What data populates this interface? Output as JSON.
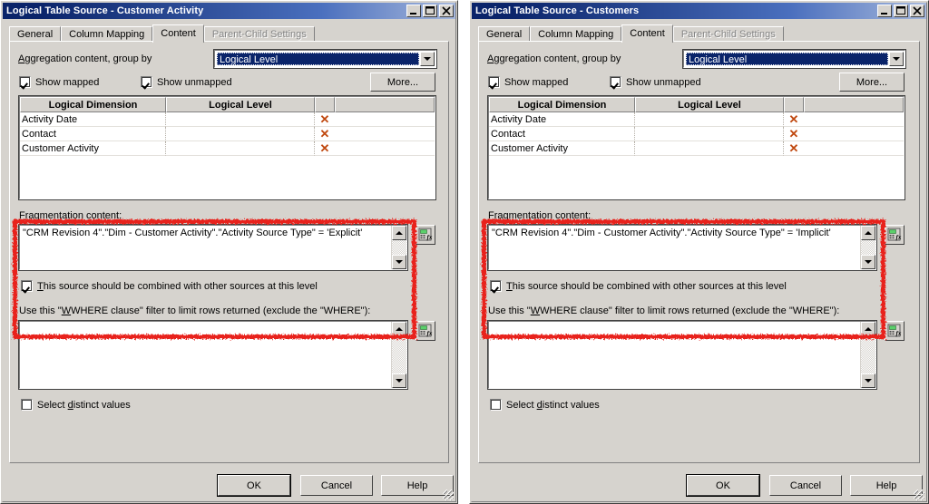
{
  "windows": [
    {
      "title": "Logical Table Source - Customer Activity",
      "titlebar_buttons": {
        "minimize": "minimize-icon",
        "maximize": "maximize-icon",
        "close": "close-icon"
      },
      "tabs": [
        {
          "label": "General",
          "state": "normal"
        },
        {
          "label": "Column Mapping",
          "state": "normal"
        },
        {
          "label": "Content",
          "state": "selected"
        },
        {
          "label": "Parent-Child Settings",
          "state": "disabled"
        }
      ],
      "aggregation": {
        "label": "Aggregation content, group by",
        "group_by_value": "Logical Level",
        "show_mapped_label": "Show mapped",
        "show_mapped_checked": true,
        "show_unmapped_label": "Show unmapped",
        "show_unmapped_checked": true,
        "more_label": "More..."
      },
      "grid": {
        "columns": [
          "Logical Dimension",
          "Logical Level",
          ""
        ],
        "rows": [
          {
            "dimension": "Activity Date",
            "level": "",
            "action": "delete-x-icon"
          },
          {
            "dimension": "Contact",
            "level": "",
            "action": "delete-x-icon"
          },
          {
            "dimension": "Customer Activity",
            "level": "",
            "action": "delete-x-icon"
          }
        ]
      },
      "fragmentation": {
        "label": "Fragmentation content:",
        "value": "\"CRM Revision 4\".\"Dim - Customer Activity\".\"Activity Source Type\" = 'Explicit'",
        "expression_button": "expression-builder-icon",
        "combine_label": "This source should be combined with other sources at this level",
        "combine_checked": true
      },
      "where": {
        "label": "Use this \"WHERE clause\" filter to limit rows returned (exclude the \"WHERE\"):",
        "value": "",
        "expression_button": "expression-builder-icon",
        "distinct_label": "Select distinct values",
        "distinct_checked": false
      },
      "buttons": {
        "ok": "OK",
        "cancel": "Cancel",
        "help": "Help"
      }
    },
    {
      "title": "Logical Table Source - Customers",
      "titlebar_buttons": {
        "minimize": "minimize-icon",
        "maximize": "maximize-icon",
        "close": "close-icon"
      },
      "tabs": [
        {
          "label": "General",
          "state": "normal"
        },
        {
          "label": "Column Mapping",
          "state": "normal"
        },
        {
          "label": "Content",
          "state": "selected"
        },
        {
          "label": "Parent-Child Settings",
          "state": "disabled"
        }
      ],
      "aggregation": {
        "label": "Aggregation content, group by",
        "group_by_value": "Logical Level",
        "show_mapped_label": "Show mapped",
        "show_mapped_checked": true,
        "show_unmapped_label": "Show unmapped",
        "show_unmapped_checked": true,
        "more_label": "More..."
      },
      "grid": {
        "columns": [
          "Logical Dimension",
          "Logical Level",
          ""
        ],
        "rows": [
          {
            "dimension": "Activity Date",
            "level": "",
            "action": "delete-x-icon"
          },
          {
            "dimension": "Contact",
            "level": "",
            "action": "delete-x-icon"
          },
          {
            "dimension": "Customer Activity",
            "level": "",
            "action": "delete-x-icon"
          }
        ]
      },
      "fragmentation": {
        "label": "Fragmentation content:",
        "value": "\"CRM Revision 4\".\"Dim - Customer Activity\".\"Activity Source Type\" = 'Implicit'",
        "expression_button": "expression-builder-icon",
        "combine_label": "This source should be combined with other sources at this level",
        "combine_checked": true
      },
      "where": {
        "label": "Use this \"WHERE clause\" filter to limit rows returned (exclude the \"WHERE\"):",
        "value": "",
        "expression_button": "expression-builder-icon",
        "distinct_label": "Select distinct values",
        "distinct_checked": false
      },
      "buttons": {
        "ok": "OK",
        "cancel": "Cancel",
        "help": "Help"
      }
    }
  ],
  "annotation": {
    "type": "red-rectangle-highlight",
    "color": "#e8201f",
    "targets": [
      "fragmentation-content-section",
      "fragmentation-content-section"
    ]
  }
}
